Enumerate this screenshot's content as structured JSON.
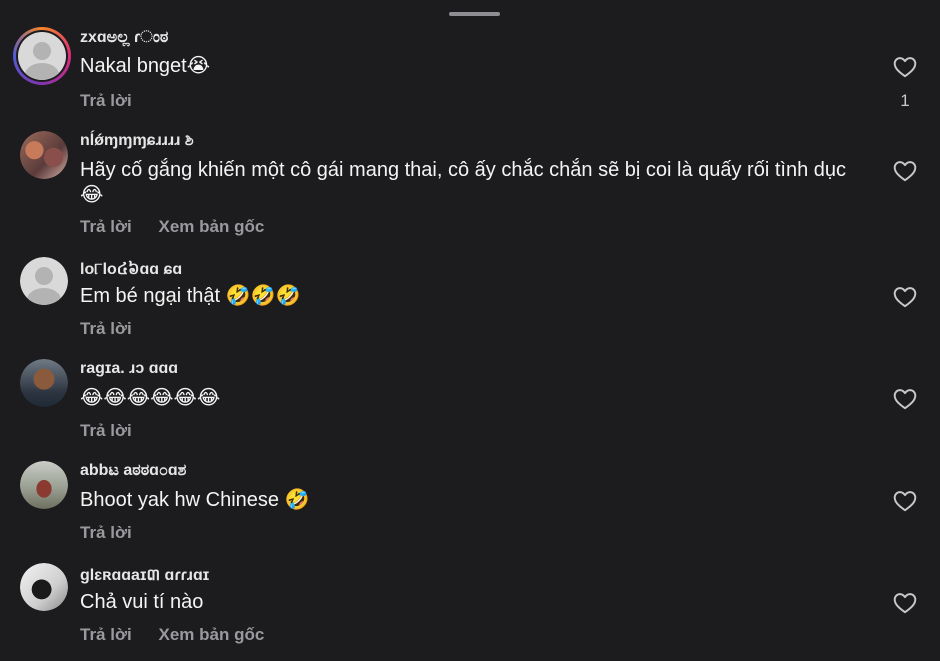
{
  "comments": [
    {
      "username": "zxɑಅಲ್ಲ ɾಂಠ",
      "text": "Nakal bnget😭",
      "actions": [
        "Trả lời"
      ],
      "likes": "1",
      "avatar": "default-avatar"
    },
    {
      "username": "nĺǿɱɱɱɕɹɹɹɹ ಶಿ",
      "text": "Hãy cố gắng khiến một cô gái mang thai, cô ấy chắc chắn sẽ bị coi là quấy rối tình dục 😂",
      "actions": [
        "Trả lời",
        "Xem bản gốc"
      ],
      "likes": "",
      "avatar": "group-photo"
    },
    {
      "username": "lo୮lo៤៦ɑɑ ɕɑ",
      "text": "Em bé ngại thật 🤣🤣🤣",
      "actions": [
        "Trả lời"
      ],
      "likes": "",
      "avatar": "default-avatar"
    },
    {
      "username": "ragɪa. ɹɔ ɑɑɑ",
      "text": "😂😂😂😂😂😂",
      "actions": [
        "Trả lời"
      ],
      "likes": "",
      "avatar": "boy-photo"
    },
    {
      "username": "abbಟ aಠಠɑ೦ɑಶ",
      "text": "Bhoot yak hw Chinese 🤣",
      "actions": [
        "Trả lời"
      ],
      "likes": "",
      "avatar": "outdoor-photo"
    },
    {
      "username": "glɛʀɑɑaɪ៣ ɑɾɾɹɑɪ",
      "text": "Chả vui tí nào",
      "actions": [
        "Trả lời",
        "Xem bản gốc"
      ],
      "likes": "",
      "avatar": "bw-photo"
    }
  ],
  "icons": {
    "like": "heart-outline-icon"
  },
  "colors": {
    "background": "#1c1c1e",
    "action_text": "#9a9a9e"
  }
}
